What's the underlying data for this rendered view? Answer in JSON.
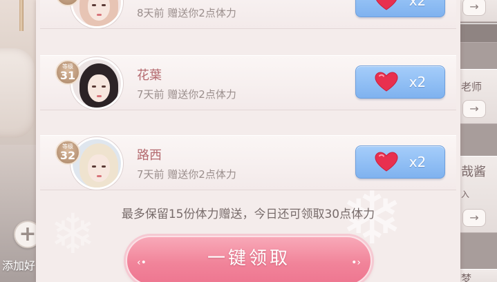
{
  "colors": {
    "panel_bg": "#f4eceb",
    "name_color": "#b46a6f",
    "claim_button": "#8dbdf4",
    "claim_all_button": "#f1849a",
    "heart": "#e8304f"
  },
  "friends": [
    {
      "level": "",
      "level_label": "",
      "name": "",
      "gift_note": "8天前 赠送你2点体力",
      "claim_icon": "heart-icon",
      "claim_qty": "x2"
    },
    {
      "level": "31",
      "level_label": "等级",
      "name": "花葉",
      "gift_note": "7天前 赠送你2点体力",
      "claim_icon": "heart-icon",
      "claim_qty": "x2"
    },
    {
      "level": "32",
      "level_label": "等级",
      "name": "路西",
      "gift_note": "7天前 赠送你2点体力",
      "claim_icon": "heart-icon",
      "claim_qty": "x2"
    }
  ],
  "limit_note": "最多保留15份体力赠送，今日还可领取30点体力",
  "claim_all_label": "一键领取",
  "add_friend": {
    "icon": "plus-icon",
    "label": "添加好"
  },
  "side_panel": {
    "text_1": "老师",
    "text_2": "哉酱",
    "text_3": "入",
    "text_4": "梦",
    "arrow_icon": "arrow-right-icon"
  }
}
